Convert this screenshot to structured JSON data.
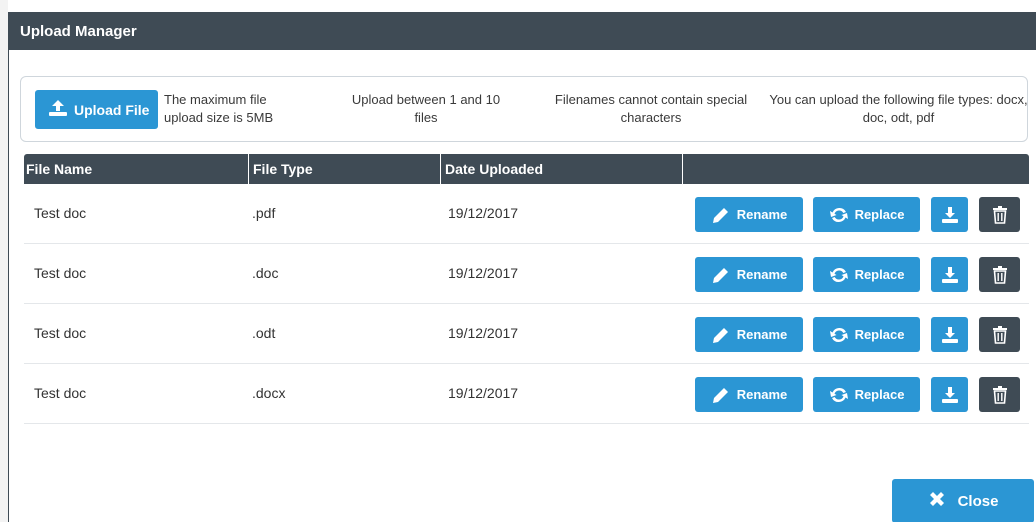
{
  "modal": {
    "title": "Upload Manager"
  },
  "upload": {
    "button_label": "Upload File",
    "info": [
      "The maximum file upload size is 5MB",
      "Upload between 1 and 10 files",
      "Filenames cannot contain special characters",
      "You can upload the following file types: docx, doc, odt, pdf"
    ]
  },
  "table": {
    "headers": [
      "File Name",
      "File Type",
      "Date Uploaded",
      ""
    ],
    "rows": [
      {
        "name": "Test doc",
        "type": ".pdf",
        "date": "19/12/2017"
      },
      {
        "name": "Test doc",
        "type": ".doc",
        "date": "19/12/2017"
      },
      {
        "name": "Test doc",
        "type": ".odt",
        "date": "19/12/2017"
      },
      {
        "name": "Test doc",
        "type": ".docx",
        "date": "19/12/2017"
      }
    ],
    "actions": {
      "rename_label": "Rename",
      "replace_label": "Replace"
    }
  },
  "footer": {
    "close_label": "Close"
  },
  "colors": {
    "header": "#3f4b55",
    "accent": "#2b96d4",
    "delete": "#3f4b55"
  },
  "icons": {
    "upload": "upload-icon",
    "rename": "pencil-icon",
    "replace": "refresh-icon",
    "download": "download-icon",
    "delete": "trash-icon",
    "close": "close-icon"
  }
}
